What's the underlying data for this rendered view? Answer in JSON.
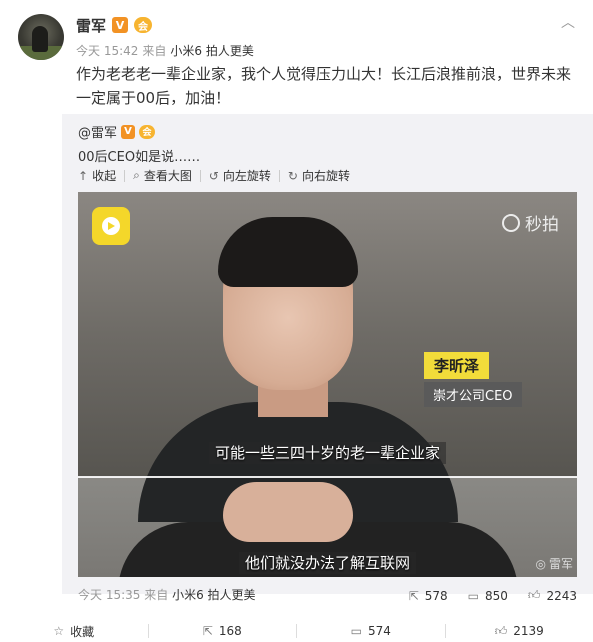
{
  "author": {
    "name": "雷军",
    "badge_v": "V",
    "badge_vip": "会"
  },
  "post": {
    "time": "今天 15:42",
    "from": "来自",
    "device": "小米6 拍人更美",
    "text": "作为老老老一辈企业家，我个人觉得压力山大！长江后浪推前浪，世界未来一定属于00后，加油！"
  },
  "repost": {
    "author": "@雷军",
    "text": "00后CEO如是说……",
    "toolbar": {
      "collapse": "收起",
      "view_large": "查看大图",
      "rotate_left": "向左旋转",
      "rotate_right": "向右旋转"
    },
    "video": {
      "brand": "秒拍",
      "name_tag": "李昕泽",
      "title_tag": "崇才公司CEO",
      "subtitle_1": "可能一些三四十岁的老一辈企业家",
      "subtitle_2": "他们就没办法了解互联网",
      "watermark": "雷军"
    },
    "footer": {
      "time": "今天 15:35",
      "from": "来自",
      "device": "小米6 拍人更美"
    },
    "stats": {
      "reposts": "578",
      "comments": "850",
      "likes": "2243"
    }
  },
  "actions": {
    "favorite": "收藏",
    "reposts": "168",
    "comments": "574",
    "likes": "2139"
  }
}
